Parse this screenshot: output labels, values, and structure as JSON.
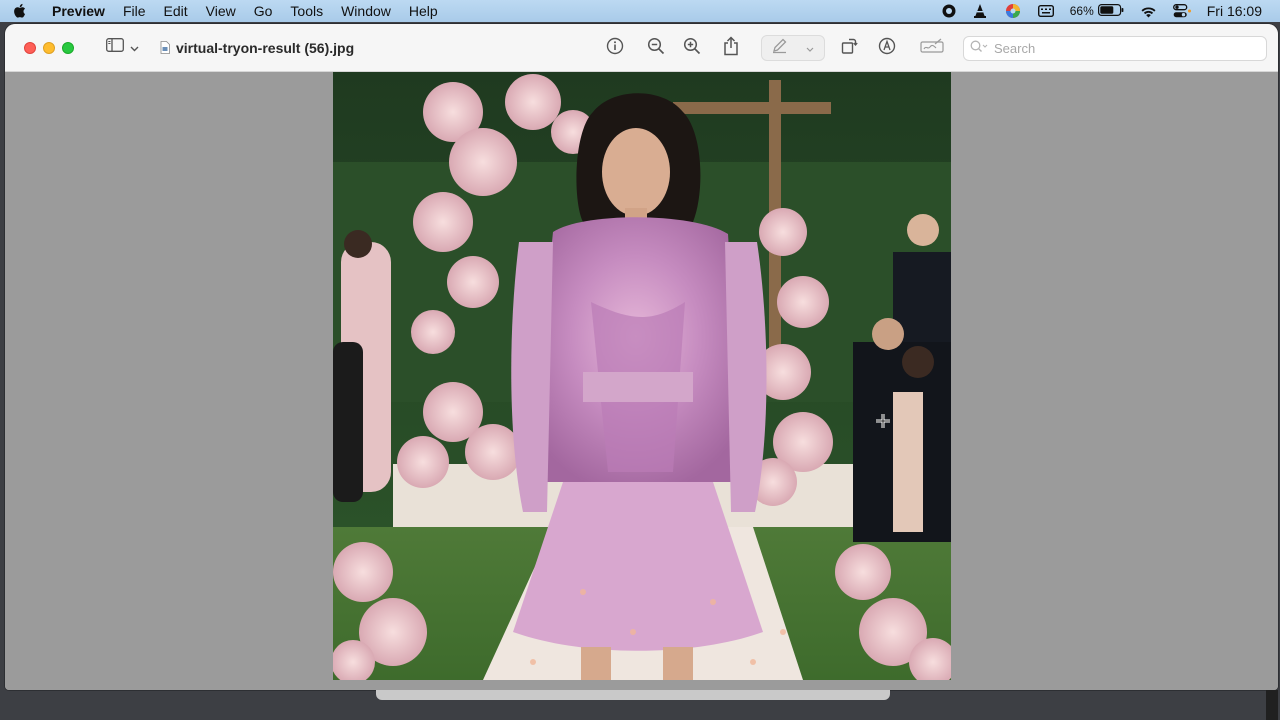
{
  "menubar": {
    "app": "Preview",
    "menus": [
      "File",
      "Edit",
      "View",
      "Go",
      "Tools",
      "Window",
      "Help"
    ],
    "battery_percent": "66%",
    "clock": "Fri 16:09"
  },
  "window": {
    "title": "virtual-tryon-result (56).jpg",
    "search_placeholder": "Search"
  },
  "icons": {
    "apple": "apple-icon",
    "record": "screen-record-icon",
    "vlc": "vlc-cone-icon",
    "color": "colorsync-icon",
    "keyboard": "keyboard-input-icon",
    "battery": "battery-icon",
    "wifi": "wifi-icon",
    "control": "control-center-icon"
  },
  "image": {
    "description_alt": "virtual-tryon-result (56).jpg"
  }
}
